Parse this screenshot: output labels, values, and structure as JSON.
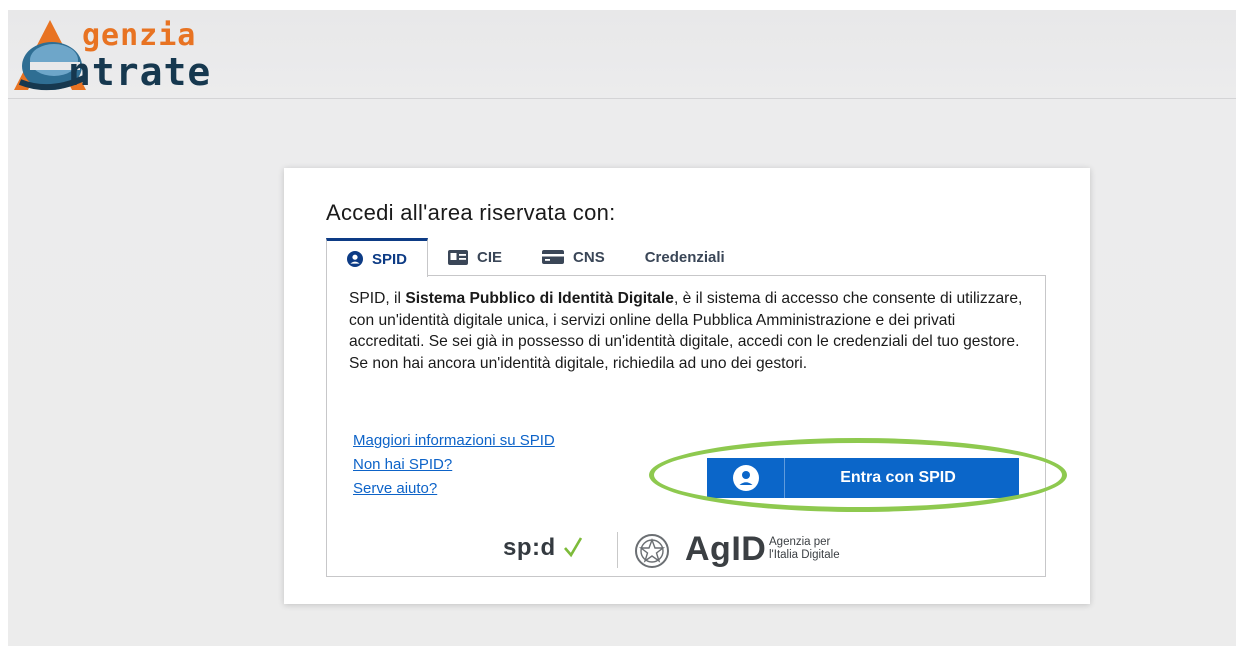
{
  "header": {
    "logo_line1": "genzia",
    "logo_line2": "ntrate"
  },
  "login": {
    "title": "Accedi all'area riservata con:",
    "tabs": [
      {
        "label": "SPID",
        "active": true
      },
      {
        "label": "CIE",
        "active": false
      },
      {
        "label": "CNS",
        "active": false
      },
      {
        "label": "Credenziali",
        "active": false
      }
    ],
    "description": {
      "part1": "SPID, il ",
      "bold": "Sistema Pubblico di Identità Digitale",
      "part2": ", è il sistema di accesso che consente di utilizzare, con un'identità digitale unica, i servizi online della Pubblica Amministrazione e dei privati accreditati. Se sei già in possesso di un'identità digitale, accedi con le credenziali del tuo gestore. Se non hai ancora un'identità digitale, richiedila ad uno dei gestori."
    },
    "links": [
      "Maggiori informazioni su SPID",
      "Non hai SPID?",
      "Serve aiuto?"
    ],
    "spid_button_label": "Entra con SPID",
    "footer": {
      "spid_logo": "sp:d",
      "agid_logo": "AgID",
      "agid_sub_line1": "Agenzia per",
      "agid_sub_line2": "l'Italia Digitale"
    }
  },
  "colors": {
    "accent_blue": "#0b66c9",
    "tab_active": "#0d3b85",
    "link": "#0d63c8",
    "highlight_ring": "#8ec94f",
    "logo_orange": "#e87322",
    "logo_navy": "#16384f"
  }
}
